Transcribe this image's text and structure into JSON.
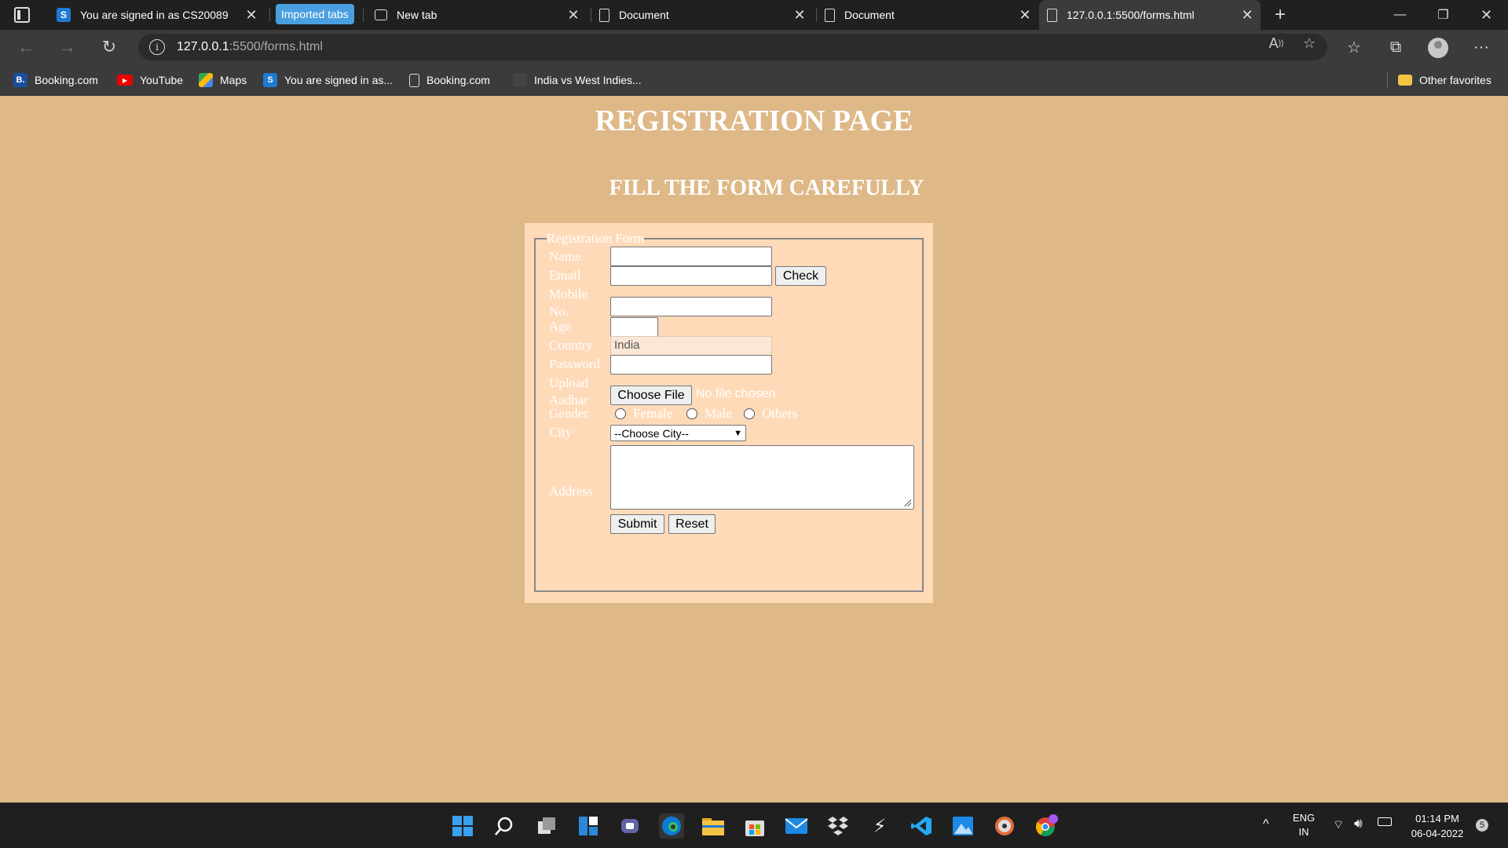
{
  "tabs": [
    {
      "title": "You are signed in as CS20089",
      "favicon": "S"
    },
    {
      "title": "Imported tabs"
    },
    {
      "title": "New tab"
    },
    {
      "title": "Document"
    },
    {
      "title": "Document"
    },
    {
      "title": "127.0.0.1:5500/forms.html"
    }
  ],
  "address": {
    "host": "127.0.0.1",
    "rest": ":5500/forms.html"
  },
  "bookmarks": [
    {
      "label": "Booking.com",
      "icon": "B."
    },
    {
      "label": "YouTube",
      "icon": "youtube-icon"
    },
    {
      "label": "Maps",
      "icon": "maps-icon"
    },
    {
      "label": "You are signed in as...",
      "icon": "S"
    },
    {
      "label": "Booking.com",
      "icon": "document-icon"
    },
    {
      "label": "India vs West Indies...",
      "icon": "blank-icon"
    },
    {
      "label": "Other favorites",
      "icon": "folder-icon"
    }
  ],
  "page": {
    "title": "REGISTRATION PAGE",
    "subtitle": "FILL THE FORM CAREFULLY"
  },
  "form": {
    "legend": "Registration Form",
    "labels": {
      "name": "Name",
      "email": "Email",
      "mobile_1": "Mobile",
      "mobile_2": "No.",
      "age": "Age",
      "country": "Country",
      "password": "Password",
      "upload_1": "Upload",
      "upload_2": "Aadhar",
      "gender": "Gender",
      "city": "City",
      "address": "Address"
    },
    "check_button": "Check",
    "country_value": "India",
    "choose_file": "Choose File",
    "no_file": "No file chosen",
    "gender_options": [
      "Female",
      "Male",
      "Others"
    ],
    "city_selected": "--Choose City--",
    "submit": "Submit",
    "reset": "Reset"
  },
  "tray": {
    "lang_1": "ENG",
    "lang_2": "IN",
    "time": "01:14 PM",
    "date": "06-04-2022",
    "notifications": "5"
  },
  "colors": {
    "page_bg": "#deb887",
    "form_bg": "#ffdab9",
    "chrome_bg": "#202020"
  }
}
